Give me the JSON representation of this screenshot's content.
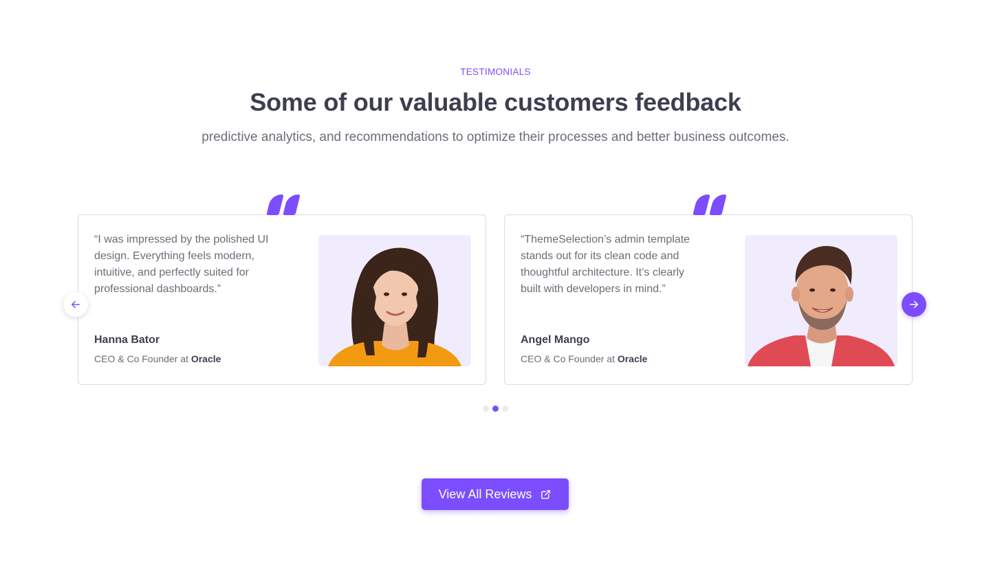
{
  "section": {
    "eyebrow": "TESTIMONIALS",
    "title": "Some of our valuable customers feedback",
    "subtitle": "predictive analytics, and recommendations to optimize their processes and better business outcomes."
  },
  "testimonials": [
    {
      "quote": "“I was impressed by the polished UI design. Everything feels modern, intuitive, and perfectly suited for professional dashboards.”",
      "name": "Hanna Bator",
      "role_prefix": "CEO & Co Founder at",
      "company": "Oracle"
    },
    {
      "quote": "“ThemeSelection’s admin template stands out for its clean code and thoughtful architecture. It’s clearly built with developers in mind.”",
      "name": "Angel Mango",
      "role_prefix": "CEO & Co Founder at",
      "company": "Oracle"
    }
  ],
  "carousel": {
    "prev_icon": "arrow-left-icon",
    "next_icon": "arrow-right-icon",
    "page_count": 3,
    "active_page": 2
  },
  "cta": {
    "label": "View All Reviews",
    "icon": "external-link-icon"
  },
  "colors": {
    "accent": "#7c4dff",
    "heading": "#3d3e4f",
    "body": "#6d6b77",
    "photo_bg": "#f1ecfd"
  }
}
